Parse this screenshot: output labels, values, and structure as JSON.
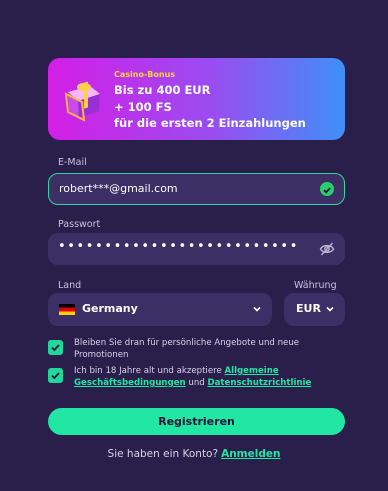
{
  "banner": {
    "tag": "Casino-Bonus",
    "line1": "Bis zu 400 EUR",
    "line2": "+ 100 FS",
    "line3": "für die ersten 2 Einzahlungen",
    "icon": "gift-box-icon"
  },
  "email": {
    "label": "E-Mail",
    "value": "robert***@gmail.com",
    "status_icon": "check-circle-icon"
  },
  "password": {
    "label": "Passwort",
    "value": "••••••••••••••••••••••••••",
    "toggle_icon": "eye-off-icon"
  },
  "country": {
    "label": "Land",
    "value": "Germany",
    "flag_icon": "germany-flag-icon"
  },
  "currency": {
    "label": "Währung",
    "value": "EUR"
  },
  "consents": {
    "offers": "Bleiben Sie dran für persönliche Angebote und neue Promotionen",
    "terms_prefix": "Ich bin 18 Jahre alt und akzeptiere ",
    "terms_link": "Allgemeine Geschäftsbedingungen",
    "terms_and": " und ",
    "privacy_link": "Datenschutzrichtlinie"
  },
  "register_label": "Registrieren",
  "footer": {
    "question": "Sie haben ein Konto?",
    "login_link": "Anmelden"
  },
  "colors": {
    "background": "#2a1f4a",
    "field": "#3b2f66",
    "accent": "#21e6a4",
    "bonus_tag": "#ffd23c"
  }
}
